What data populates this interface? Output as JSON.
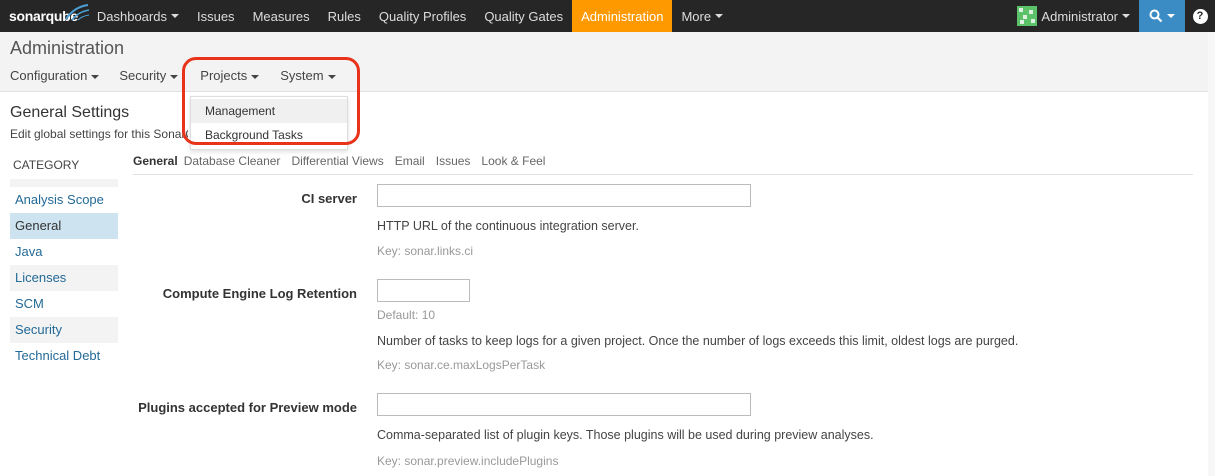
{
  "topnav": {
    "logo": "sonarqube",
    "items": [
      {
        "label": "Dashboards",
        "caret": true
      },
      {
        "label": "Issues"
      },
      {
        "label": "Measures"
      },
      {
        "label": "Rules"
      },
      {
        "label": "Quality Profiles"
      },
      {
        "label": "Quality Gates"
      },
      {
        "label": "Administration",
        "active": true
      },
      {
        "label": "More",
        "caret": true
      }
    ],
    "user": "Administrator",
    "search_icon": "search-icon",
    "help_icon": "?",
    "colors": {
      "bar": "#262626",
      "active": "#ff9900",
      "search": "#3b8cc4"
    }
  },
  "admin": {
    "title": "Administration",
    "subnav": [
      {
        "label": "Configuration"
      },
      {
        "label": "Security"
      },
      {
        "label": "Projects"
      },
      {
        "label": "System"
      }
    ],
    "dropdown": [
      "Management",
      "Background Tasks"
    ]
  },
  "page": {
    "title": "General Settings",
    "description": "Edit global settings for this SonarQube instance."
  },
  "category": {
    "heading": "CATEGORY",
    "items": [
      "Analysis Scope",
      "General",
      "Java",
      "Licenses",
      "SCM",
      "Security",
      "Technical Debt"
    ],
    "selected": "General"
  },
  "tabs": [
    "General",
    "Database Cleaner",
    "Differential Views",
    "Email",
    "Issues",
    "Look & Feel"
  ],
  "settings": [
    {
      "label": "CI server",
      "value": "",
      "help": "HTTP URL of the continuous integration server.",
      "key": "Key: sonar.links.ci"
    },
    {
      "label": "Compute Engine Log Retention",
      "value": "",
      "default": "Default: 10",
      "help": "Number of tasks to keep logs for a given project. Once the number of logs exceeds this limit, oldest logs are purged.",
      "key": "Key: sonar.ce.maxLogsPerTask"
    },
    {
      "label": "Plugins accepted for Preview mode",
      "value": "",
      "help": "Comma-separated list of plugin keys. Those plugins will be used during preview analyses.",
      "key": "Key: sonar.preview.includePlugins"
    }
  ]
}
